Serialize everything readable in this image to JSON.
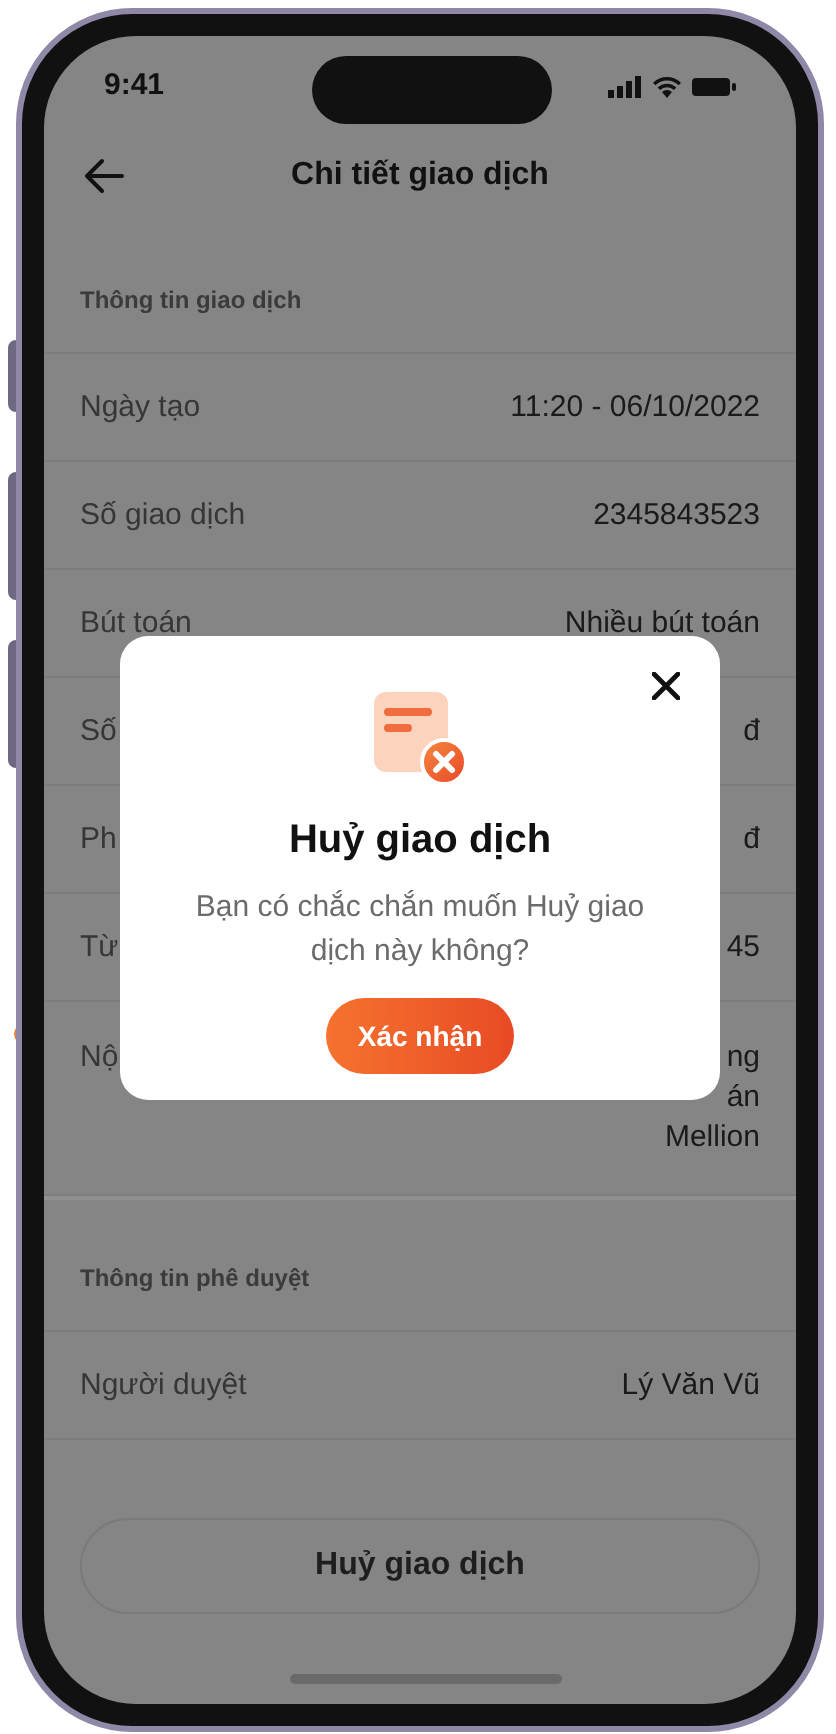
{
  "status_bar": {
    "time": "9:41"
  },
  "header": {
    "title": "Chi tiết giao dịch"
  },
  "sections": [
    {
      "title": "Thông tin giao dịch",
      "rows": [
        {
          "label": "Ngày tạo",
          "value_lines": [
            "11:20 - 06/10/2022"
          ]
        },
        {
          "label": "Số giao dịch",
          "value_lines": [
            "2345843523"
          ]
        },
        {
          "label": "Bút toán",
          "value_lines": [
            "Nhiều bút toán"
          ]
        },
        {
          "label": "Số",
          "value_lines": [
            "đ"
          ]
        },
        {
          "label": "Ph",
          "value_lines": [
            "đ"
          ]
        },
        {
          "label": "Từ",
          "value_lines": [
            "45"
          ]
        },
        {
          "label": "Nộ",
          "value_lines": [
            "ng",
            "án",
            "Mellion"
          ]
        }
      ]
    },
    {
      "title": "Thông tin phê duyệt",
      "rows": [
        {
          "label": "Người duyệt",
          "value_lines": [
            "Lý Văn Vũ"
          ]
        }
      ]
    }
  ],
  "footer_button": {
    "label": "Huỷ giao dịch"
  },
  "modal": {
    "title": "Huỷ giao dịch",
    "message": "Bạn có chắc chắn muốn Huỷ giao dịch này không?",
    "confirm_label": "Xác nhận"
  }
}
